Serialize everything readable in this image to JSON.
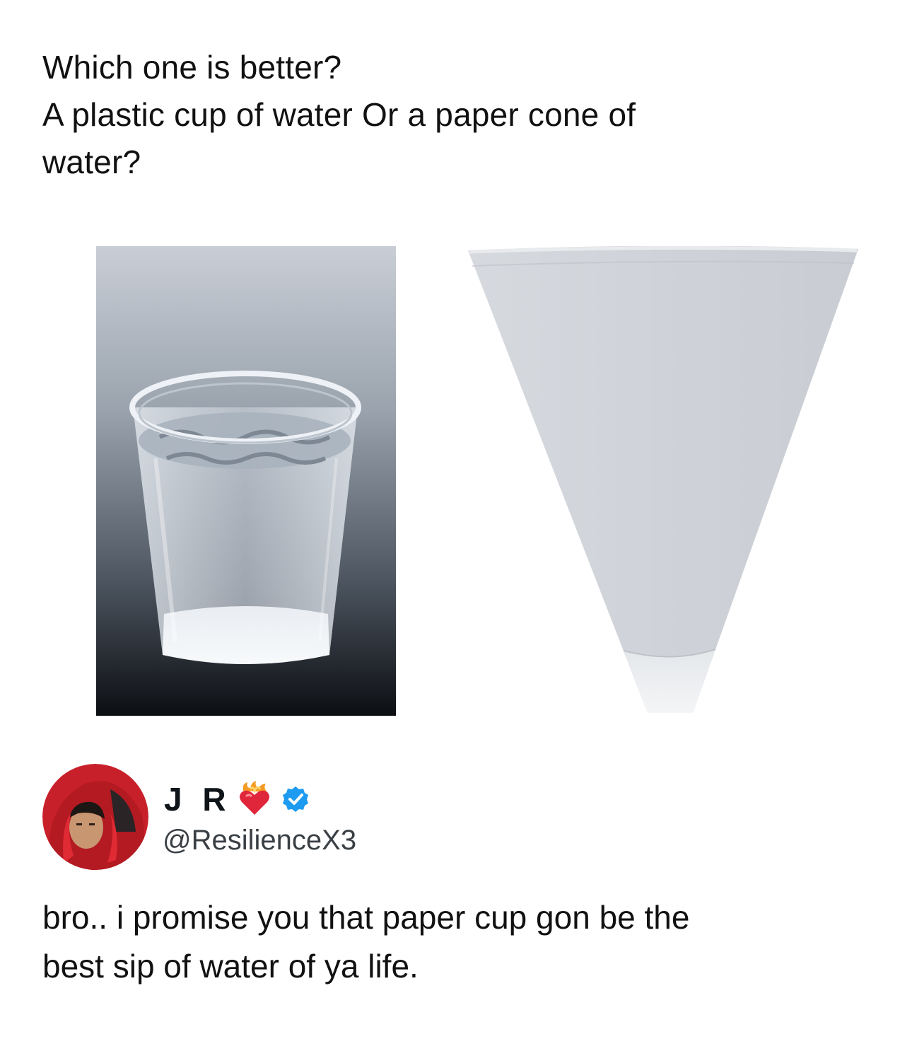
{
  "post": {
    "question_lines": [
      "Which one is better?",
      "A plastic cup of water Or a paper cone of",
      "water?"
    ]
  },
  "media": {
    "left_image": "plastic-cup-of-water-photo",
    "right_image": "paper-cone-cup-photo"
  },
  "reply": {
    "display_name": "J R",
    "handle": "@ResilienceX3",
    "badge_icons": [
      "heart-on-fire-icon",
      "verified-badge-icon"
    ],
    "text_lines": [
      "bro.. i promise you that paper cup gon be the",
      "best sip of water of ya life."
    ]
  },
  "colors": {
    "verified": "#1d9bf0",
    "hoodie_red": "#c8202a",
    "text": "#111111",
    "handle": "#3a3f44"
  }
}
